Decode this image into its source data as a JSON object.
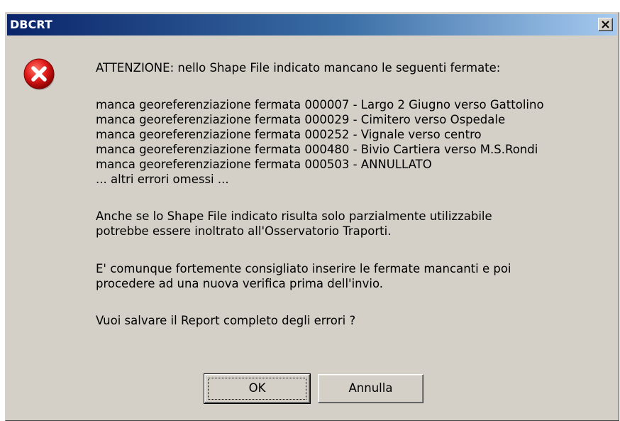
{
  "window": {
    "title": "DBCRT"
  },
  "message": {
    "header": "ATTENZIONE: nello Shape File indicato mancano le seguenti fermate:",
    "errors": [
      "manca georeferenziazione fermata 000007 - Largo 2 Giugno verso Gattolino",
      "manca georeferenziazione fermata 000029 - Cimitero verso Ospedale",
      "manca georeferenziazione fermata 000252 - Vignale verso centro",
      "manca georeferenziazione fermata 000480 - Bivio Cartiera verso M.S.Rondi",
      "manca georeferenziazione fermata 000503 - ANNULLATO"
    ],
    "omitted": "... altri errori omessi ...",
    "partial_line1": "Anche se lo Shape File indicato risulta solo parzialmente utilizzabile",
    "partial_line2": "potrebbe essere inoltrato all'Osservatorio Traporti.",
    "advice_line1": "E' comunque fortemente consigliato inserire le fermate mancanti e poi",
    "advice_line2": "procedere ad una nuova verifica prima dell'invio.",
    "question": "Vuoi salvare il Report completo degli errori ?"
  },
  "buttons": {
    "ok_label": "OK",
    "cancel_label": "Annulla"
  },
  "icons": {
    "error": "error-icon",
    "close": "close-icon"
  },
  "colors": {
    "title_start": "#0a246a",
    "title_end": "#a6caf0",
    "dialog_bg": "#d4d0c8",
    "error_red": "#d41414"
  }
}
